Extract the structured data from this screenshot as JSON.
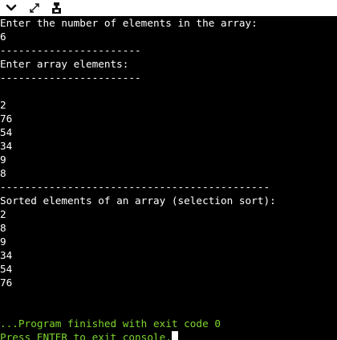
{
  "toolbar": {
    "icons": [
      "chevron-down-icon",
      "expand-icon",
      "stdin-icon"
    ]
  },
  "console": {
    "lines": [
      "Enter the number of elements in the array:",
      "6",
      "-----------------------",
      "Enter array elements:",
      "-----------------------",
      "",
      "2",
      "76",
      "54",
      "34",
      "9",
      "8",
      "--------------------------------------------",
      "Sorted elements of an array (selection sort):",
      "2",
      "8",
      "9",
      "34",
      "54",
      "76",
      "",
      "",
      "...Program finished with exit code 0",
      "Press ENTER to exit console."
    ],
    "colors": {
      "background": "#000000",
      "text": "#ffffff",
      "status": "#7dd52f"
    }
  }
}
